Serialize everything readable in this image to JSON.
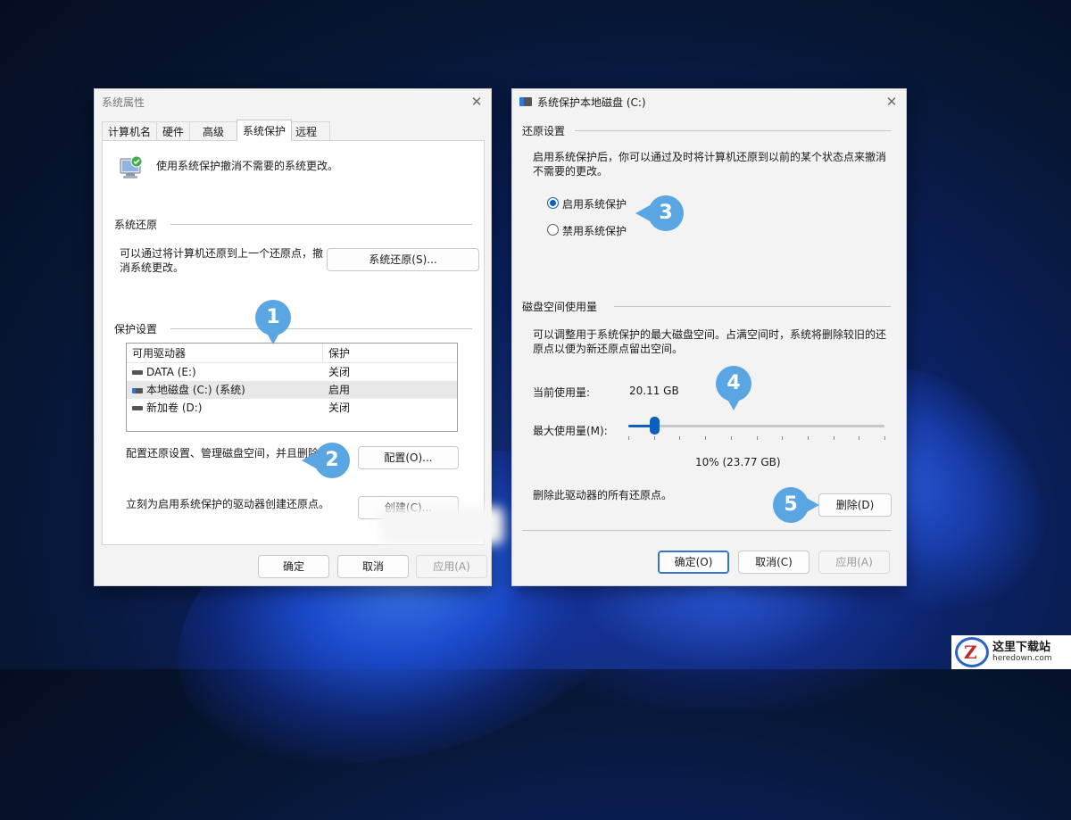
{
  "colors": {
    "accent": "#0a5fc0",
    "callout": "#5aa6e3"
  },
  "sysprop": {
    "title": "系统属性",
    "tabs": [
      "计算机名",
      "硬件",
      "高级",
      "系统保护",
      "远程"
    ],
    "active_tab": "系统保护",
    "intro": "使用系统保护撤消不需要的系统更改。",
    "restore_group": "系统还原",
    "restore_desc": "可以通过将计算机还原到上一个还原点，撤消系统更改。",
    "restore_button": "系统还原(S)...",
    "protect_group": "保护设置",
    "list_headers": [
      "可用驱动器",
      "保护"
    ],
    "drives": [
      {
        "name": "DATA (E:)",
        "status": "关闭",
        "icon": "drive-icon"
      },
      {
        "name": "本地磁盘 (C:) (系统)",
        "status": "启用",
        "icon": "system-drive-icon"
      },
      {
        "name": "新加卷 (D:)",
        "status": "关闭",
        "icon": "drive-icon"
      }
    ],
    "config_desc": "配置还原设置、管理磁盘空间，并且删除还原",
    "config_button": "配置(O)...",
    "create_desc": "立刻为启用系统保护的驱动器创建还原点。",
    "create_button": "创建(C)...",
    "ok": "确定",
    "cancel": "取消",
    "apply": "应用(A)"
  },
  "protect_c": {
    "title": "系统保护本地磁盘 (C:)",
    "restore_settings": "还原设置",
    "restore_desc": "启用系统保护后，你可以通过及时将计算机还原到以前的某个状态点来撤消不需要的更改。",
    "enable_label": "启用系统保护",
    "disable_label": "禁用系统保护",
    "enabled": true,
    "disk_usage_group": "磁盘空间使用量",
    "disk_desc": "可以调整用于系统保护的最大磁盘空间。占满空间时，系统将删除较旧的还原点以便为新还原点留出空间。",
    "current_usage_label": "当前使用量:",
    "current_usage_value": "20.11 GB",
    "max_usage_label": "最大使用量(M):",
    "max_usage_fraction": 0.1,
    "max_usage_value": "10% (23.77 GB)",
    "delete_desc": "删除此驱动器的所有还原点。",
    "delete_button": "删除(D)",
    "ok": "确定(O)",
    "cancel": "取消(C)",
    "apply": "应用(A)"
  },
  "callouts": [
    "1",
    "2",
    "3",
    "4",
    "5"
  ],
  "watermark": {
    "cn": "这里下载站",
    "en": "heredown.com"
  }
}
